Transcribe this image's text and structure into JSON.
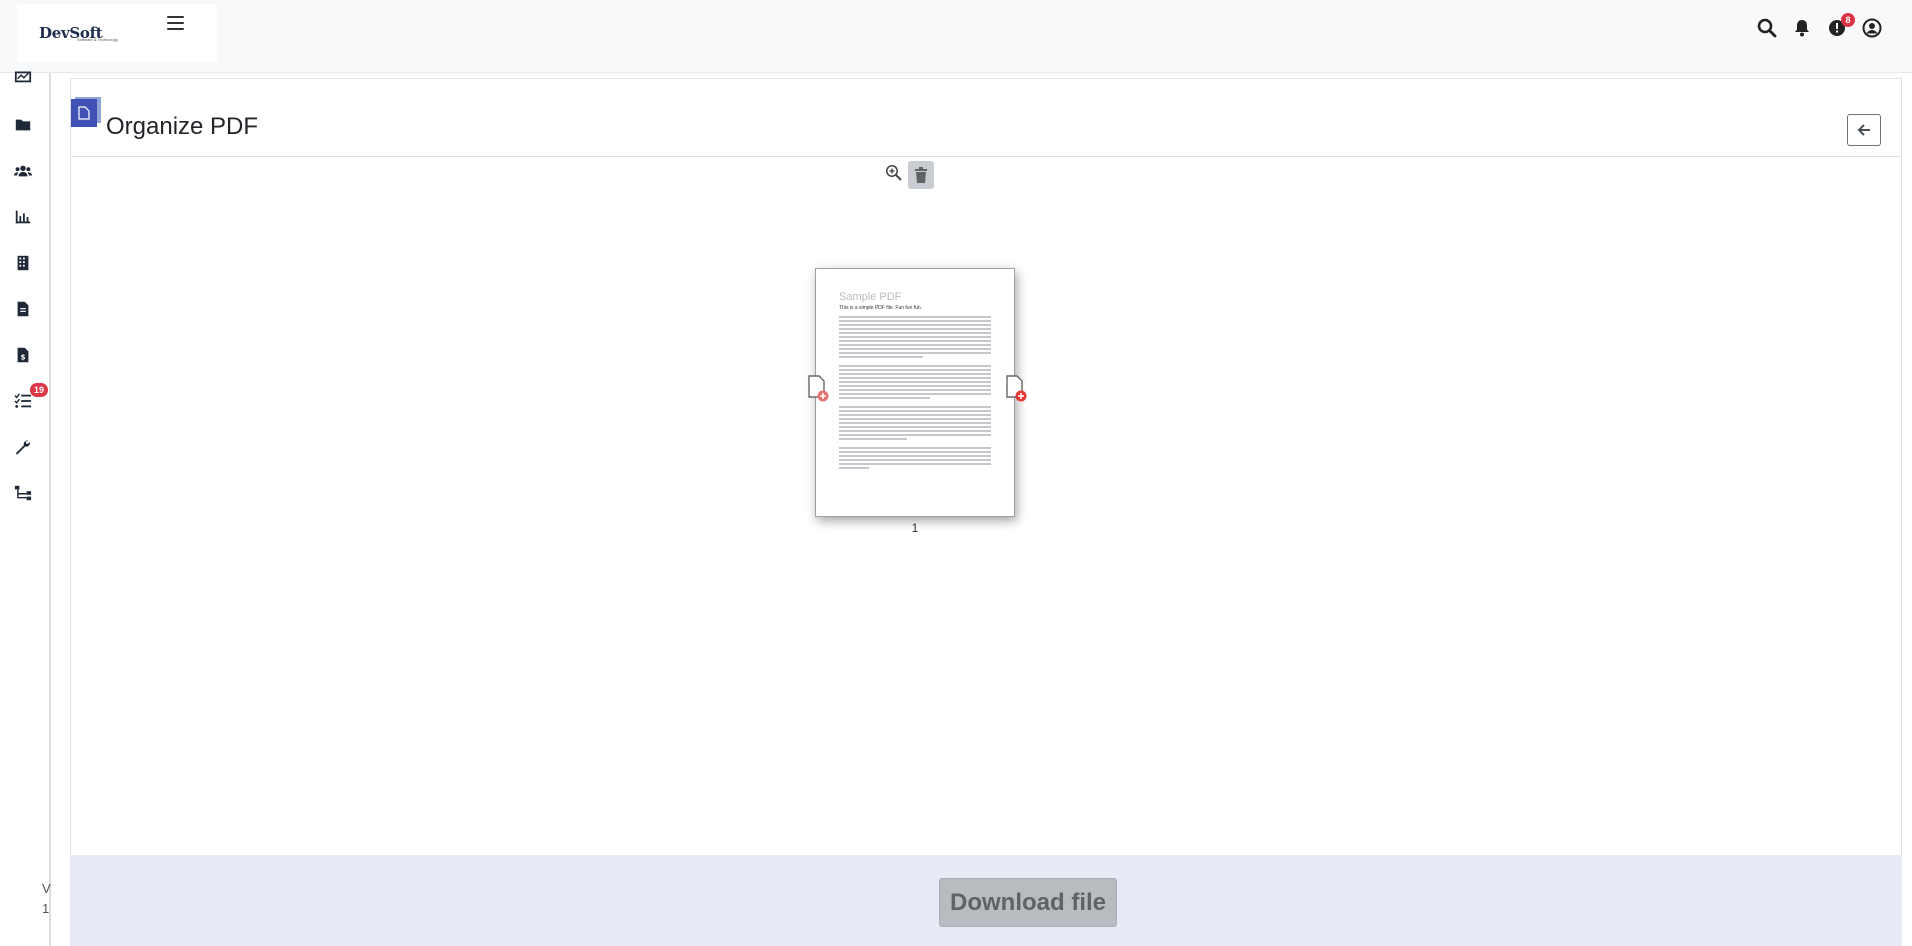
{
  "brand": {
    "name_part1": "DevSoft",
    "name_part2": "",
    "tagline": "Software & Technology"
  },
  "topbar": {
    "alert_count": "8"
  },
  "sidebar": {
    "tasks_badge": "19",
    "footer_line1": "V",
    "footer_line2": "1"
  },
  "page": {
    "title": "Organize PDF"
  },
  "pdf": {
    "page_title": "Sample PDF",
    "page_subtitle": "This is a simple PDF file. Fun fun fun.",
    "page_number": "1"
  },
  "footer": {
    "download_label": "Download file"
  },
  "colors": {
    "accent": "#3f51b5",
    "badge": "#dc3545",
    "bottom_bar": "#e8eaf6"
  }
}
